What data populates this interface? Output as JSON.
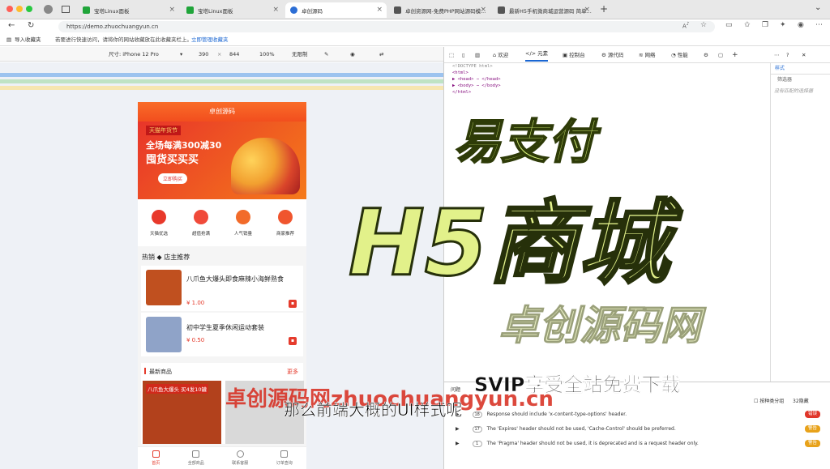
{
  "browser": {
    "tabs": [
      {
        "title": "宝塔Linux面板",
        "fav_color": "#20a53a"
      },
      {
        "title": "宝塔Linux面板",
        "fav_color": "#20a53a"
      },
      {
        "title": "卓创源码",
        "fav_color": "#2c6ed5"
      },
      {
        "title": "卓创资源网-免费PHP网站源码模...",
        "fav_color": "#555"
      },
      {
        "title": "最新H5手机微商城运营源码 简单...",
        "fav_color": "#555"
      }
    ],
    "url": "https://demo.zhuochuangyun.cn",
    "favbar": {
      "import": "导入收藏夹",
      "hint": "若要进行快速访问，请将你的网站收藏放在此收藏夹栏上。",
      "manage": "立即管理收藏夹"
    }
  },
  "device_toolbar": {
    "size_label": "尺寸: iPhone 12 Pro",
    "width": "390",
    "height": "844",
    "zoom": "100%",
    "throttle": "无限制"
  },
  "phone": {
    "header_title": "卓创源码",
    "banner": {
      "tag": "天猫年货节",
      "line1": "全场每满300减30",
      "line2": "囤货买买买",
      "button": "立即购买"
    },
    "icons": [
      {
        "label": "天猫优选",
        "color": "#e8392b"
      },
      {
        "label": "超值抢满",
        "color": "#f04a3a"
      },
      {
        "label": "人气销量",
        "color": "#f26b2a"
      },
      {
        "label": "商家推荐",
        "color": "#f0552e"
      }
    ],
    "section_hot": "热销 ◆ 店主推荐",
    "products": [
      {
        "name": "八爪鱼大爆头即食麻辣小海鲜熟食",
        "price": "¥ 1.00",
        "img_color": "#c0501f"
      },
      {
        "name": "初中学生夏季休闲运动套装",
        "price": "¥ 0.50",
        "img_color": "#8fa3c8"
      }
    ],
    "new_title": "最新商品",
    "new_more": "更多",
    "new_banner": "八爪鱼大爆头 买4发10罐",
    "bottom_tabs": [
      "首页",
      "全部商品",
      "联系客服",
      "订单查询"
    ]
  },
  "devtools": {
    "tabs": [
      "欢迎",
      "元素",
      "控制台",
      "源代码",
      "网络",
      "性能"
    ],
    "dom_lines": [
      "<!DOCTYPE html>",
      "<html>",
      "▶ <head> ⋯ </head>",
      "▶ <body> ⋯ </body>",
      "</html>"
    ],
    "styles_tab": "样式",
    "filter": "筛选器",
    "no_match": "没有匹配的选择器",
    "console_label": "问题",
    "group_label": "按种类分组",
    "hidden_count": "32隐藏",
    "issues": [
      {
        "count": "18",
        "text": "Response should include 'x-content-type-options' header.",
        "badge": "错误",
        "badge_color": "#e0362a"
      },
      {
        "count": "17",
        "text": "The 'Expires' header should not be used, 'Cache-Control' should be preferred.",
        "badge": "警告",
        "badge_color": "#e8a21a"
      },
      {
        "count": "1",
        "text": "The 'Pragma' header should not be used, it is deprecated and is a request header only.",
        "badge": "警告",
        "badge_color": "#e8a21a"
      }
    ]
  },
  "overlays": {
    "title1": "易支付",
    "title2": "H5商城",
    "title3": "卓创源码网",
    "promo": "SVIP享受全站免费下载",
    "watermark": "卓创源码网zhuochuangyun.cn",
    "subtitle": "那么前端大概的UI样式呢"
  }
}
